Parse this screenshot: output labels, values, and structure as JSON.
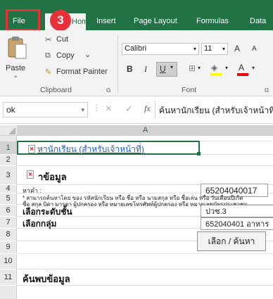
{
  "ribbon_tabs": {
    "file": "File",
    "home": "Home",
    "insert": "Insert",
    "page_layout": "Page Layout",
    "formulas": "Formulas",
    "data": "Data"
  },
  "step_marker": "3",
  "clipboard": {
    "paste": "Paste",
    "cut": "Cut",
    "copy": "Copy",
    "format_painter": "Format Painter",
    "group_label": "Clipboard"
  },
  "font_group": {
    "font_name": "Calibri",
    "font_size": "11",
    "grow": "A",
    "shrink": "A",
    "bold": "B",
    "italic": "I",
    "underline": "U",
    "font_color_letter": "A",
    "group_label": "Font"
  },
  "formula_bar": {
    "name_box": "ok",
    "cancel": "×",
    "enter": "✓",
    "fx": "fx",
    "content": "ค้นหานักเรียน (สำหรับเจ้าหน้าที่)"
  },
  "sheet": {
    "column_a": "A",
    "row_numbers": [
      "1",
      "2",
      "3",
      "4",
      "5",
      "6",
      "7",
      "8",
      "9",
      "10",
      "11"
    ],
    "title_link": "หานักเรียน (สำหรับเจ้าหน้าที่)",
    "section_search": "าข้อมูล",
    "search_label": "หาคำ :",
    "search_note_1": "* สามารถค้นหาโดย ของ รหัสนักเรียน หรือ ชื่อ หรือ นามสกุล หรือ ชื่อเล่น หรือ วันเดือนปีเกิด",
    "search_note_2": "ชื่อ สกุล บิดา มารดา ผู้ปกครอง หรือ หมายเลขโทรศัพท์ผู้ปกครอง หรือ หมายเลขบัตรประชาชน",
    "search_value": "65204040017",
    "level_label": "เลือกระดับชั้น",
    "level_value": "ปวช.3",
    "group_label": "เลือกกลุ่ม",
    "group_value": "652040401 อาหาร",
    "search_button": "เลือก / ค้นหา",
    "results_heading": "ค้นพบข้อมูล"
  },
  "colors": {
    "ribbon_green": "#217346",
    "highlight_red": "#e8303a"
  }
}
